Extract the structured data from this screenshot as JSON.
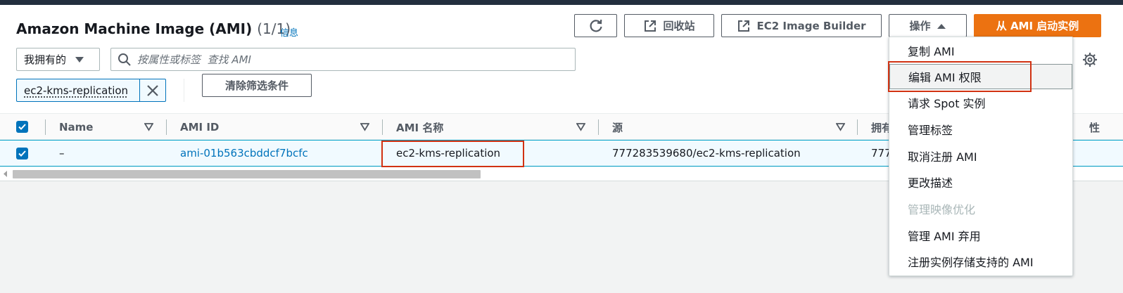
{
  "header": {
    "title": "Amazon Machine Image (AMI)",
    "count": "(1/1)",
    "info_link": "信息"
  },
  "toolbar": {
    "refresh_icon": "refresh-icon",
    "recycle_bin_label": "回收站",
    "image_builder_label": "EC2 Image Builder",
    "actions_label": "操作",
    "launch_label": "从 AMI 启动实例"
  },
  "filter": {
    "owner_select_value": "我拥有的",
    "search_placeholder": "按属性或标签  查找 AMI",
    "token_label": "ec2-kms-replication",
    "clear_filters_label": "清除筛选条件"
  },
  "table": {
    "columns": [
      "Name",
      "AMI ID",
      "AMI 名称",
      "源",
      "拥有",
      "性"
    ],
    "rows": [
      {
        "name": "–",
        "ami_id": "ami-01b563cbddcf7bcfc",
        "ami_name": "ec2-kms-replication",
        "source": "777283539680/ec2-kms-replication",
        "owner": "777"
      }
    ]
  },
  "actions_menu": {
    "items": [
      {
        "label": "复制 AMI",
        "disabled": false
      },
      {
        "label": "编辑 AMI 权限",
        "disabled": false
      },
      {
        "label": "请求 Spot 实例",
        "disabled": false
      },
      {
        "label": "管理标签",
        "disabled": false
      },
      {
        "label": "取消注册 AMI",
        "disabled": false
      },
      {
        "label": "更改描述",
        "disabled": false
      },
      {
        "label": "管理映像优化",
        "disabled": true
      },
      {
        "label": "管理 AMI 弃用",
        "disabled": false
      },
      {
        "label": "注册实例存储支持的 AMI",
        "disabled": false
      }
    ]
  },
  "colors": {
    "primary_button": "#ec7211",
    "link": "#0073bb",
    "highlight_annotation": "#d13212",
    "top_bar": "#232f3e"
  }
}
